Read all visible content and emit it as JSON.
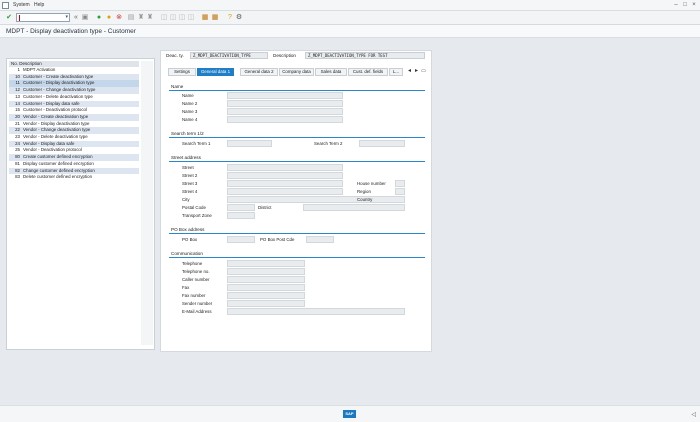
{
  "menubar": {
    "items": [
      "System",
      "Help"
    ]
  },
  "toolbar": {
    "okcode_value": ""
  },
  "title": "MDPT - Display deactivation type - Customer",
  "list": {
    "header": "No. Description",
    "rows": [
      {
        "code": "1",
        "desc": "MDPT Activation"
      },
      {
        "code": "10",
        "desc": "Customer - Create deactivation type"
      },
      {
        "code": "11",
        "desc": "Customer - Display deactivation type"
      },
      {
        "code": "12",
        "desc": "Customer - Change deactivation type"
      },
      {
        "code": "13",
        "desc": "Customer - Delete deactivation type"
      },
      {
        "code": "14",
        "desc": "Customer - Display data safe"
      },
      {
        "code": "15",
        "desc": "Customer - Deactivation protocol"
      },
      {
        "code": "20",
        "desc": "Vendor - Create deactivation type"
      },
      {
        "code": "21",
        "desc": "Vendor - Display deactivation type"
      },
      {
        "code": "22",
        "desc": "Vendor - Change deactivation type"
      },
      {
        "code": "23",
        "desc": "Vendor - Delete deactivation type"
      },
      {
        "code": "24",
        "desc": "Vendor - Display data safe"
      },
      {
        "code": "25",
        "desc": "Vendor - Deactivation protocol"
      },
      {
        "code": "80",
        "desc": "Create customer defined encryption"
      },
      {
        "code": "81",
        "desc": "Display customer defined encryption"
      },
      {
        "code": "82",
        "desc": "Change customer defined encryption"
      },
      {
        "code": "83",
        "desc": "Delete customer defined encryption"
      }
    ]
  },
  "header": {
    "deac_label": "Deac. ty.",
    "deac_value": "Z_MDPT_DEACTIVATION_TYPE",
    "desc_label": "Description",
    "desc_value": "Z_MDPT_DEACTIVATION_TYPE FOR TEST"
  },
  "tabs": [
    "Settings",
    "General data 1",
    "General data 2",
    "Company data",
    "Sales data",
    "Cust. def. fields",
    "L..."
  ],
  "groups": {
    "name": {
      "title": "Name",
      "fields": [
        "Name",
        "Name 2",
        "Name 3",
        "Name 4"
      ]
    },
    "search": {
      "title": "Search term 1/2",
      "term1": "Search Term 1",
      "term2": "Search Term 2"
    },
    "street": {
      "title": "Street address",
      "fields": [
        "Street",
        "Street 2",
        "Street 3",
        "Street 4",
        "City",
        "Postal Code",
        "Transport Zone"
      ],
      "right_fields": [
        "House number",
        "Region",
        "Country"
      ],
      "district": "District"
    },
    "pobox": {
      "title": "PO Box address",
      "po_box": "PO Box",
      "po_box_code": "PO Box Post Cde"
    },
    "comm": {
      "title": "Communication",
      "fields": [
        "Telephone",
        "Telephone no.",
        "Caller number",
        "Fax",
        "Fax number",
        "Sender number",
        "E-Mail Address"
      ]
    }
  },
  "colors": {
    "accent": "#1f7ec6",
    "stripe": "#dde6f0"
  }
}
